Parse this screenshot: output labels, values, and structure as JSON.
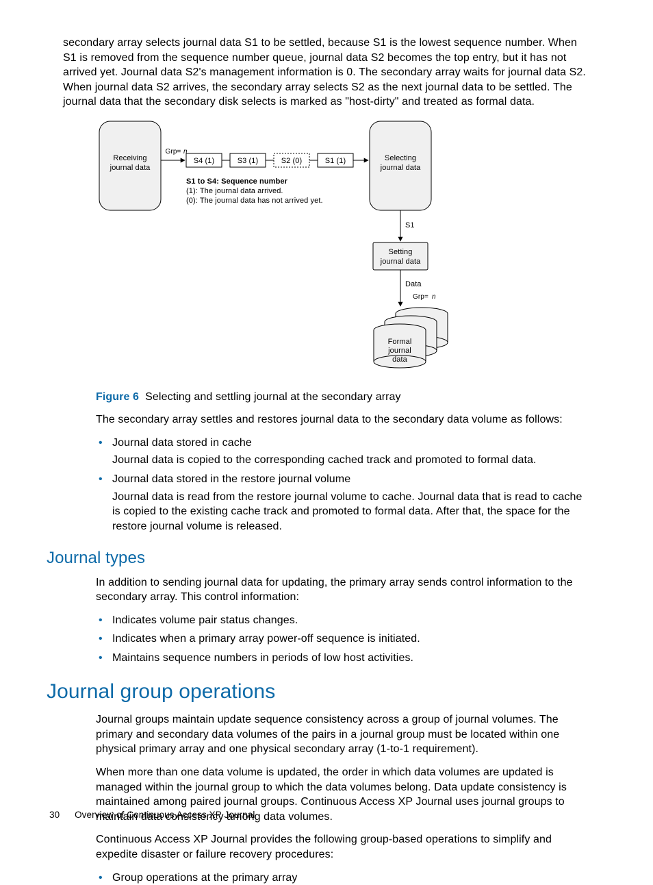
{
  "paragraphs": {
    "intro": "secondary array selects journal data S1 to be settled, because S1 is the lowest sequence number. When S1 is removed from the sequence number queue, journal data S2 becomes the top entry, but it has not arrived yet. Journal data S2's management information is 0. The secondary array waits for journal data S2. When journal data S2 arrives, the secondary array selects S2 as the next journal data to be settled. The journal data that the secondary disk selects is marked as \"host-dirty\" and treated as formal data.",
    "settles_intro": "The secondary array settles and restores journal data to the secondary data volume as follows:",
    "journal_types_intro": "In addition to sending journal data for updating, the primary array sends control information to the secondary array. This control information:",
    "group_ops_p1": "Journal groups maintain update sequence consistency across a group of journal volumes. The primary and secondary data volumes of the pairs in a journal group must be located within one physical primary array and one physical secondary array (1-to-1 requirement).",
    "group_ops_p2": "When more than one data volume is updated, the order in which data volumes are updated is managed within the journal group to which the data volumes belong. Data update consistency is maintained among paired journal groups. Continuous Access XP Journal uses journal groups to maintain data consistency among data volumes.",
    "group_ops_p3": "Continuous Access XP Journal provides the following group-based operations to simplify and expedite disaster or failure recovery procedures:"
  },
  "figure": {
    "label": "Figure 6",
    "caption": "Selecting and settling journal at the secondary array"
  },
  "bullets_restore": [
    {
      "lead": "Journal data stored in cache",
      "sub": "Journal data is copied to the corresponding cached track and promoted to formal data."
    },
    {
      "lead": "Journal data stored in the restore journal volume",
      "sub": "Journal data is read from the restore journal volume to cache. Journal data that is read to cache is copied to the existing cache track and promoted to formal data. After that, the space for the restore journal volume is released."
    }
  ],
  "bullets_control": [
    "Indicates volume pair status changes.",
    "Indicates when a primary array power-off sequence is initiated.",
    "Maintains sequence numbers in periods of low host activities."
  ],
  "bullets_group": [
    "Group operations at the primary array"
  ],
  "headings": {
    "journal_types": "Journal types",
    "journal_group_ops": "Journal group operations"
  },
  "footer": {
    "page": "30",
    "text": "Overview of Continuous Access XP Journal"
  },
  "diagram": {
    "receiving": "Receiving\njournal data",
    "selecting": "Selecting\njournal data",
    "setting": "Setting\njournal data",
    "formal": "Formal\njournal\ndata",
    "grp": "Grp=n",
    "s1_label": "S1",
    "data_label": "Data",
    "queue": [
      "S4 (1)",
      "S3 (1)",
      "S2 (0)",
      "S1 (1)"
    ],
    "legend_title": "S1 to S4: Sequence number",
    "legend_1": "(1): The journal data arrived.",
    "legend_0": "(0): The journal data has not arrived yet."
  }
}
